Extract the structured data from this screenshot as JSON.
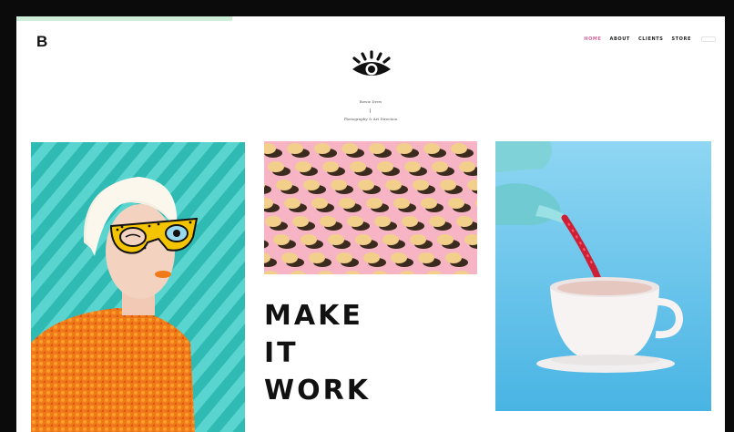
{
  "header": {
    "logo_letter": "B",
    "nav": [
      {
        "label": "HOME",
        "active": true
      },
      {
        "label": "ABOUT",
        "active": false
      },
      {
        "label": "CLIENTS",
        "active": false
      },
      {
        "label": "STORE",
        "active": false
      }
    ],
    "search_icon": "search-box"
  },
  "brand": {
    "name": "Bowie Drew",
    "tagline": "Photography & Art Direction",
    "mark_icon": "eye-icon"
  },
  "hero": {
    "headline_lines": [
      "MAKE",
      "IT",
      "WORK"
    ]
  },
  "colors": {
    "accent": "#e0649a",
    "teal": "#3cc6c0",
    "pink": "#f4b8c6",
    "sky": "#5fc2e8",
    "orange": "#f07a1a"
  },
  "tiles": [
    {
      "subject": "woman-with-yellow-glasses"
    },
    {
      "subject": "pink-pattern-with-cookies"
    },
    {
      "subject": "teapot-pouring-into-cup"
    }
  ]
}
